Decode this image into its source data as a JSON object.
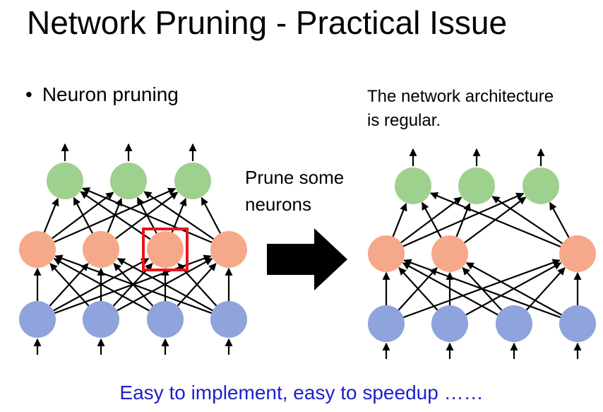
{
  "slide": {
    "title": "Network Pruning - Practical Issue",
    "bullet": "Neuron pruning",
    "bullet_marker": "•",
    "note_line1": "The network architecture",
    "note_line2": "is regular.",
    "arrow_label_line1": "Prune some",
    "arrow_label_line2": "neurons",
    "footer": "Easy to implement, easy to speedup ……"
  },
  "colors": {
    "input_neuron": "#8fa3dc",
    "hidden_neuron": "#f6a98a",
    "output_neuron": "#9fd18e",
    "highlight_box": "#e8141c",
    "footer_text": "#1f1fcc"
  },
  "diagram": {
    "left_network": {
      "layers": {
        "input": 4,
        "hidden": 4,
        "output": 3
      },
      "highlighted_hidden_index": 2
    },
    "right_network": {
      "layers": {
        "input": 4,
        "hidden": 3,
        "output": 3
      }
    }
  }
}
